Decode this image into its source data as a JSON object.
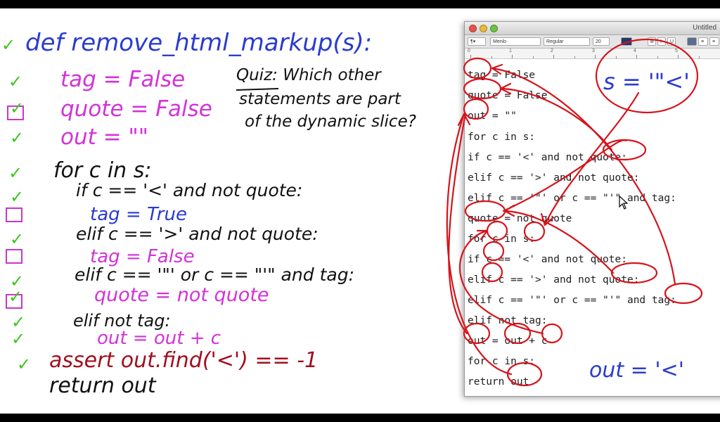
{
  "lecture": {
    "def_line": "def remove_html_markup(s):",
    "lines": [
      {
        "text": "tag = False",
        "name": "line-tag-false"
      },
      {
        "text": "quote = False",
        "name": "line-quote-false"
      },
      {
        "text": "out = \"\"",
        "name": "line-out-empty"
      },
      {
        "text": "for c in s:",
        "name": "line-for"
      },
      {
        "text": "if c == '<' and not quote:",
        "name": "line-if-lt"
      },
      {
        "text": "tag = True",
        "name": "line-tag-true"
      },
      {
        "text": "elif c == '>' and not quote:",
        "name": "line-elif-gt"
      },
      {
        "text": "tag = False",
        "name": "line-tag-false-2"
      },
      {
        "text": "elif c == '\"' or c == \"'\" and tag:",
        "name": "line-elif-quote"
      },
      {
        "text": "quote = not quote",
        "name": "line-quote-toggle"
      },
      {
        "text": "elif not tag:",
        "name": "line-elif-not-tag"
      },
      {
        "text": "out = out + c",
        "name": "line-out-append"
      },
      {
        "text": "assert out.find('<') == -1",
        "name": "line-assert"
      },
      {
        "text": "return out",
        "name": "line-return"
      }
    ],
    "quiz": [
      "Quiz: Which other",
      "statements are part",
      "of the dynamic slice?"
    ],
    "annotation_s": "s = '\"<'",
    "annotation_out": "out = '<'"
  },
  "editor": {
    "title": "Untitled",
    "font_name": "Menlo",
    "font_style": "Regular",
    "font_size": "20",
    "ruler_numbers": [
      "0",
      "1",
      "2",
      "3",
      "4",
      "5"
    ],
    "code_lines": [
      "tag = False",
      "quote = False",
      "out = \"\"",
      "for c in s:",
      "if c == '<' and not quote:",
      "elif c == '>' and not quote:",
      "elif c == '\"' or c == \"'\" and tag:",
      "quote = not quote",
      "for c in s:",
      "if c == '<' and not quote:",
      "elif c == '>' and not quote:",
      "elif c == '\"' or c == \"'\" and tag:",
      "elif not tag:",
      "out = out + c",
      "for c in s:",
      "return out"
    ]
  },
  "colors": {
    "ink_black": "#111111",
    "ink_blue": "#2a3bd0",
    "ink_magenta": "#d332d8",
    "ink_red": "#a01020",
    "check_green": "#3cc61e",
    "annotation_red": "#d4141c"
  }
}
